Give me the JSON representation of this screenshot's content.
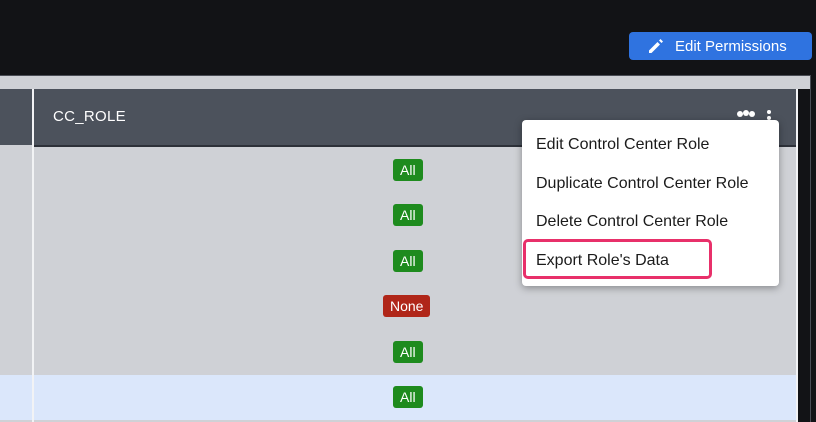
{
  "toolbar": {
    "edit_permissions_label": "Edit Permissions"
  },
  "table": {
    "column_header": "CC_ROLE",
    "rows": [
      {
        "value": "All",
        "status": "all"
      },
      {
        "value": "All",
        "status": "all"
      },
      {
        "value": "All",
        "status": "all"
      },
      {
        "value": "None",
        "status": "none"
      },
      {
        "value": "All",
        "status": "all"
      },
      {
        "value": "All",
        "status": "all",
        "selected": true
      }
    ]
  },
  "context_menu": {
    "items": [
      "Edit Control Center Role",
      "Duplicate Control Center Role",
      "Delete Control Center Role",
      "Export Role's Data"
    ],
    "highlighted_index": 3
  },
  "colors": {
    "accent": "#2f73e0",
    "all_badge": "#1e8b1e",
    "none_badge": "#b02619",
    "highlight": "#e8306a"
  },
  "icons": [
    "pencil-icon",
    "people-icon",
    "kebab-menu-icon"
  ]
}
